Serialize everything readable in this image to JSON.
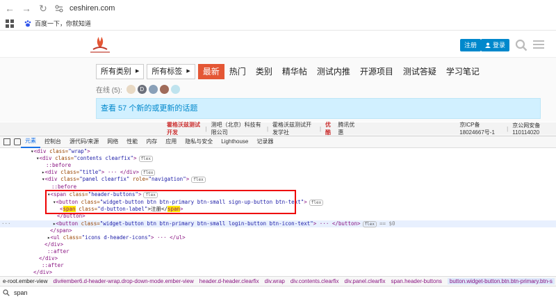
{
  "browser": {
    "url": "ceshiren.com",
    "bookmark_label": "百度一下，你就知道"
  },
  "site": {
    "signup_label": "注册",
    "login_label": "登录",
    "dropdowns": [
      {
        "label": "所有类别"
      },
      {
        "label": "所有标签"
      }
    ],
    "nav_tabs": [
      {
        "label": "最新",
        "active": true
      },
      {
        "label": "热门"
      },
      {
        "label": "类别"
      },
      {
        "label": "精华帖"
      },
      {
        "label": "测试内推"
      },
      {
        "label": "开源项目"
      },
      {
        "label": "测试答疑"
      },
      {
        "label": "学习笔记"
      }
    ],
    "online_label": "在线 (5):",
    "avatar_letter": "D",
    "banner_text": "查看 57 个新的或更新的话题"
  },
  "footer_strip": {
    "brand": "霍格沃兹测试开发",
    "company": "测吧（北京）科技有限公司",
    "school": "霍格沃兹测试开发学社",
    "youku": "优酷",
    "youku_sub": "腾讯优惠",
    "icp": "京ICP备18024667号-1",
    "police": "京公网安备 110114020"
  },
  "devtools": {
    "tabs": [
      {
        "label": "元素",
        "active": true
      },
      {
        "label": "控制台"
      },
      {
        "label": "源代码/来源"
      },
      {
        "label": "网络"
      },
      {
        "label": "性能"
      },
      {
        "label": "内存"
      },
      {
        "label": "应用"
      },
      {
        "label": "隐私与安全"
      },
      {
        "label": "Lighthouse"
      },
      {
        "label": "记录器"
      }
    ],
    "dom_lines": {
      "l0_tag": "<div ",
      "l0_attr": "class=",
      "l0_val": "\"wrap\"",
      "l0_end": ">",
      "l1_tag": "<div ",
      "l1_attr": "class=",
      "l1_val": "\"contents clearfix\"",
      "l1_end": ">",
      "l2": "::before",
      "l3_tag": "<div ",
      "l3_attr": "class=",
      "l3_val": "\"title\"",
      "l3_end": "> ··· </div>",
      "l4_tag": "<div ",
      "l4_attr": "class=",
      "l4_val": "\"panel clearfix\"",
      "l4_attr2": " role=",
      "l4_val2": "\"navigation\"",
      "l4_end": ">",
      "l5": "::before",
      "l6_tag": "<span ",
      "l6_attr": "class=",
      "l6_val": "\"header-buttons\"",
      "l6_end": ">",
      "l7_tag": "<button ",
      "l7_attr": "class=",
      "l7_val": "\"widget-button btn btn-primary btn-small sign-up-button btn-text\"",
      "l7_end": ">",
      "l8_open": "<",
      "l8_span": "span",
      "l8_attr": " class=",
      "l8_val": "\"d-button-label\"",
      "l8_text": ">注册</",
      "l8_span2": "span",
      "l8_close": ">",
      "l9": "</button>",
      "l10_tag": "<button ",
      "l10_attr": "class=",
      "l10_val": "\"widget-button btn btn-primary btn-small login-button btn-icon-text\"",
      "l10_end": "> ··· </button>",
      "l10_eq": "== $0",
      "l11": "</span>",
      "l12_tag": "<ul ",
      "l12_attr": "class=",
      "l12_val": "\"icons d-header-icons\"",
      "l12_end": "> ··· </ul>",
      "l13": "</div>",
      "l14": "::after",
      "l15": "</div>",
      "l16": "::after",
      "l17": "</div>",
      "l18": "</div>"
    },
    "pill_flex": "flex",
    "breadcrumbs": [
      "e-root.ember-view",
      "div#ember6.d-header-wrap.drop-down-mode.ember-view",
      "header.d-header.clearfix",
      "div.wrap",
      "div.contents.clearfix",
      "div.panel.clearfix",
      "span.header-buttons",
      "button.widget-button.btn.btn-primary.btn-s"
    ],
    "search_value": "span"
  },
  "colors": {
    "accent": "#e45735",
    "brand_blue": "#0088cc",
    "banner_bg": "#d1f0ff"
  }
}
